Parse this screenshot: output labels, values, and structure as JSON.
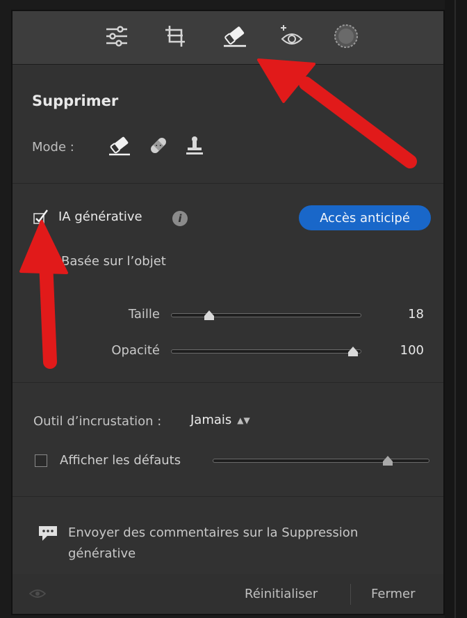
{
  "toolbar": {
    "tools": [
      {
        "icon": "sliders-icon"
      },
      {
        "icon": "crop-icon"
      },
      {
        "icon": "eraser-icon"
      },
      {
        "icon": "red-eye-icon"
      },
      {
        "icon": "mask-icon"
      }
    ]
  },
  "panel": {
    "title": "Supprimer",
    "mode_label": "Mode :",
    "mode_icons": [
      "eraser-icon",
      "bandage-icon",
      "stamp-icon"
    ],
    "generative": {
      "label": "IA générative",
      "checked": true,
      "badge": "Accès anticipé",
      "sub_label": "Basée sur l’objet"
    },
    "sliders": {
      "size": {
        "label": "Taille",
        "value": "18",
        "fraction": 0.2
      },
      "opacity": {
        "label": "Opacité",
        "value": "100",
        "fraction": 0.96
      }
    },
    "inlay": {
      "label": "Outil d’incrustation :",
      "value": "Jamais"
    },
    "defects": {
      "label": "Afficher les défauts",
      "checked": false,
      "fraction": 0.81
    },
    "feedback": {
      "text": "Envoyer des commentaires sur la Suppression générative"
    },
    "footer": {
      "reset": "Réinitialiser",
      "close": "Fermer"
    }
  },
  "colors": {
    "accent": "#1967c9",
    "annotation_arrow": "#e11a1a"
  }
}
